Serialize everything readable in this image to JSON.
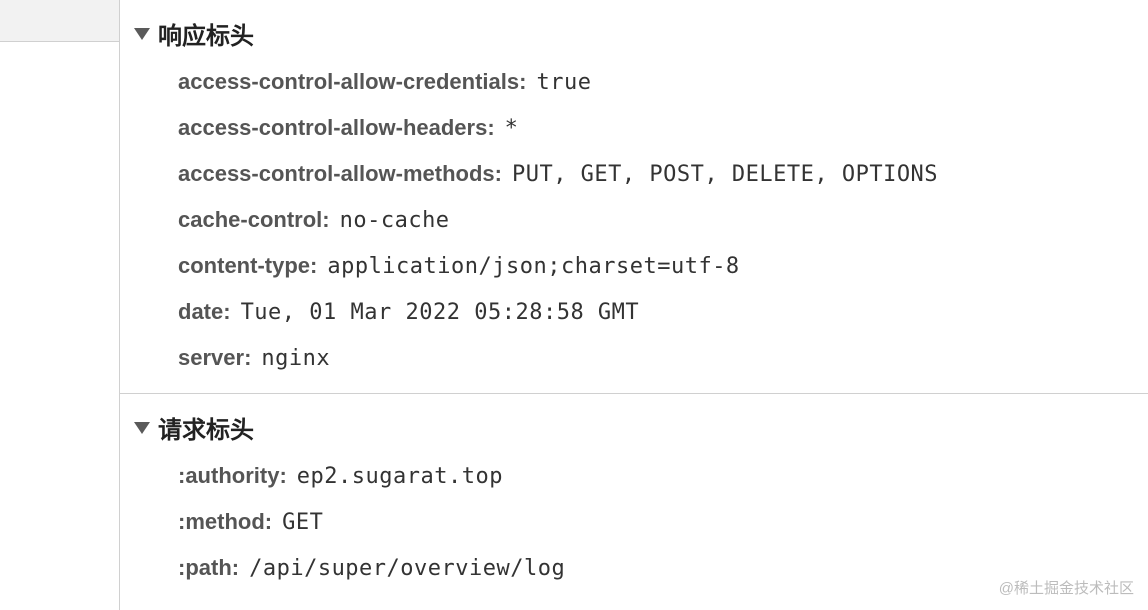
{
  "sections": [
    {
      "title": "响应标头",
      "headers": [
        {
          "name": "access-control-allow-credentials:",
          "value": "true"
        },
        {
          "name": "access-control-allow-headers:",
          "value": "*"
        },
        {
          "name": "access-control-allow-methods:",
          "value": "PUT, GET, POST, DELETE, OPTIONS"
        },
        {
          "name": "cache-control:",
          "value": "no-cache"
        },
        {
          "name": "content-type:",
          "value": "application/json;charset=utf-8"
        },
        {
          "name": "date:",
          "value": "Tue, 01 Mar 2022 05:28:58 GMT"
        },
        {
          "name": "server:",
          "value": "nginx"
        }
      ]
    },
    {
      "title": "请求标头",
      "headers": [
        {
          "name": ":authority:",
          "value": "ep2.sugarat.top"
        },
        {
          "name": ":method:",
          "value": "GET"
        },
        {
          "name": ":path:",
          "value": "/api/super/overview/log"
        }
      ]
    }
  ],
  "watermark": "@稀土掘金技术社区"
}
